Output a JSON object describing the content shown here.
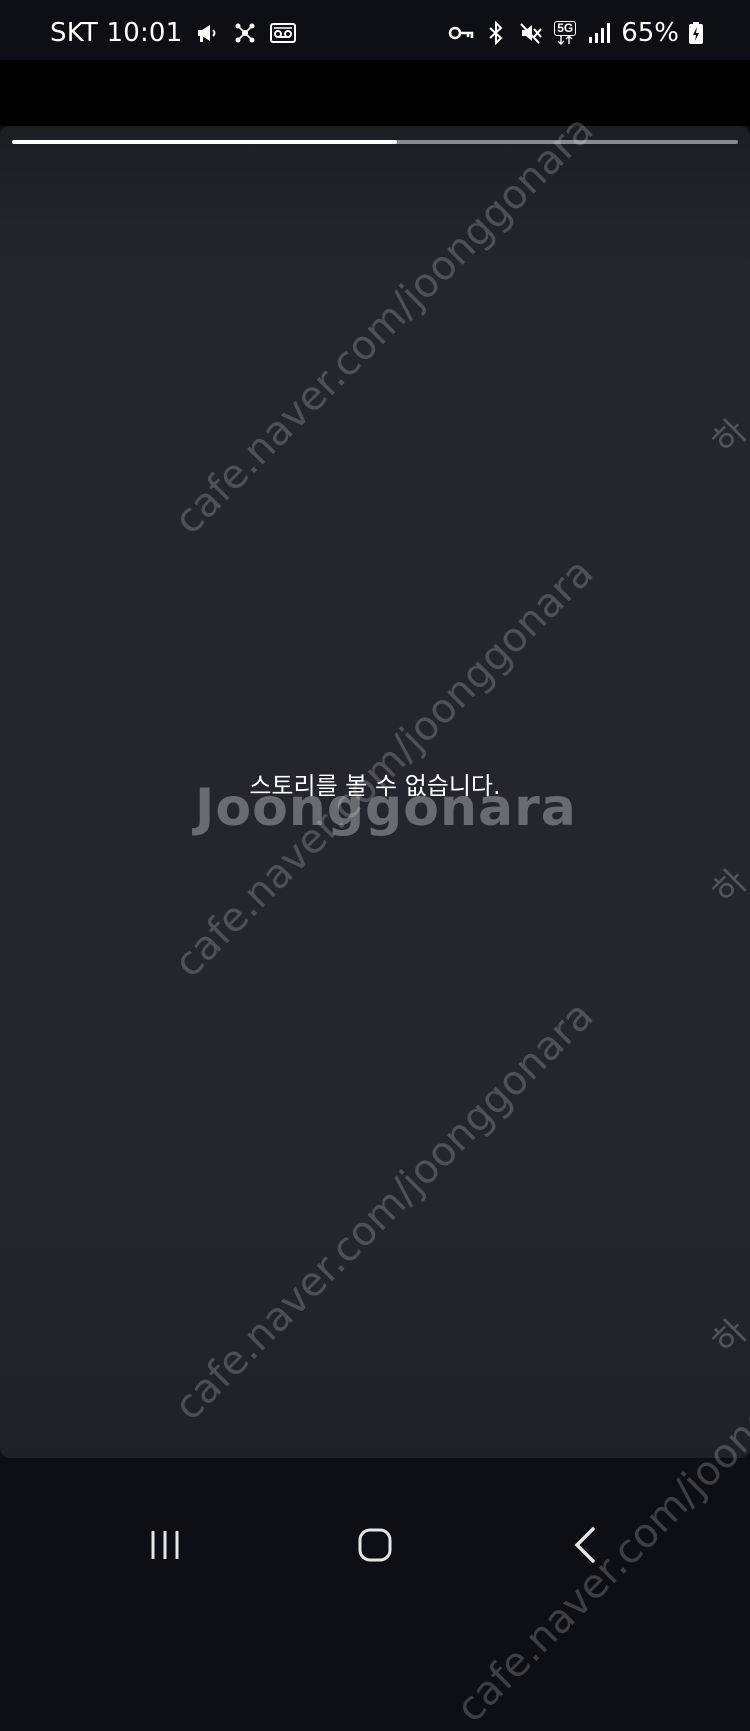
{
  "status_bar": {
    "carrier_time": "SKT 10:01",
    "battery": "65%",
    "network_badge": "5G",
    "left_icons": [
      "megaphone-icon",
      "network-nodes-icon",
      "voicemail-icon"
    ],
    "right_icons": [
      "vpn-key-icon",
      "bluetooth-icon",
      "mute-icon",
      "5g-icon",
      "signal-icon",
      "battery-charging-icon"
    ]
  },
  "story": {
    "progress": 0.53,
    "message": "스토리를 볼 수 없습니다."
  },
  "watermark": {
    "url": "cafe.naver.com/joonggonara",
    "brand": "Joonggonara",
    "side_fragment": "하"
  },
  "navigation": {
    "buttons": [
      "recent-apps",
      "home",
      "back"
    ]
  },
  "colors": {
    "background": "#0d0f14",
    "viewer": "#23262d",
    "progress_fill": "#ffffff",
    "progress_track": "#8a8c90"
  }
}
